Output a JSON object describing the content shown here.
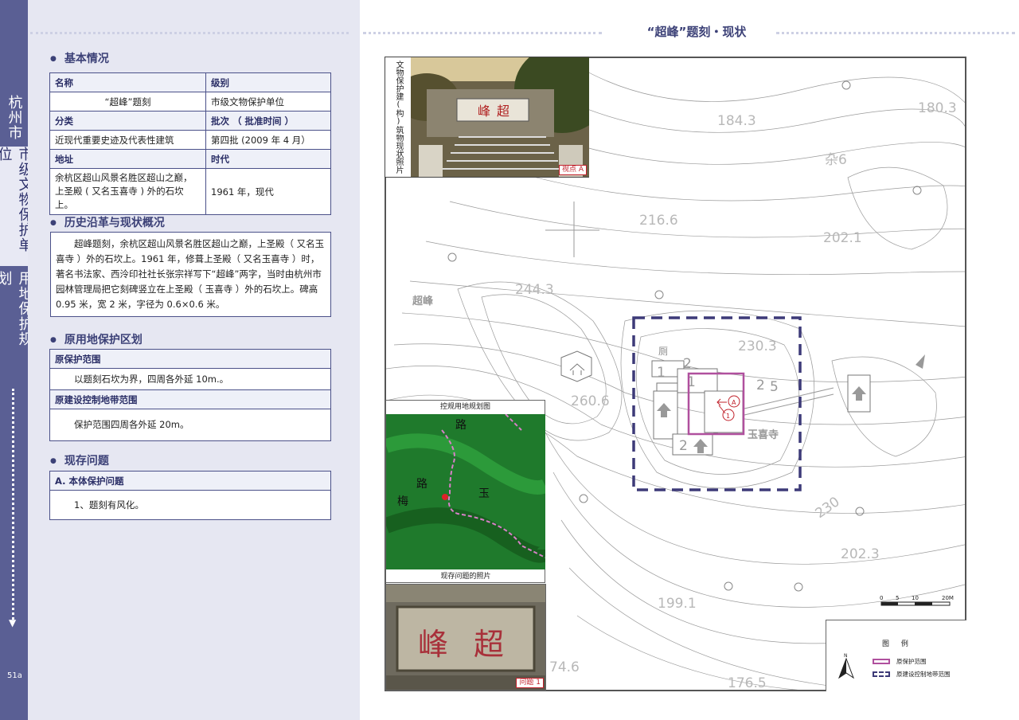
{
  "sidebar": {
    "city": "杭州市",
    "category": "市级文物保护单位",
    "section": "用地保护规划",
    "page_number": "51a"
  },
  "basic_info": {
    "title": "基本情况",
    "rows": [
      {
        "label_left": "名称",
        "label_right": "级别"
      },
      {
        "value_left": "“超峰”题刻",
        "value_right": "市级文物保护单位"
      },
      {
        "label_left": "分类",
        "label_right": "批次 （ 批准时间 ）"
      },
      {
        "value_left": "近现代重要史迹及代表性建筑",
        "value_right": "第四批 (2009 年 4 月）"
      },
      {
        "label_left": "地址",
        "label_right": "时代"
      },
      {
        "value_left_1": "余杭区超山风景名胜区超山之巅，",
        "value_left_2": "上圣殿 ( 又名玉喜寺 ) 外的石坎上。",
        "value_right": "1961 年，现代"
      }
    ]
  },
  "history": {
    "title": "历史沿革与现状概况",
    "text": "超峰题刻，余杭区超山风景名胜区超山之巅，上圣殿（ 又名玉喜寺 ）外的石坎上。1961 年，修葺上圣殿（ 又名玉喜寺 ）时，著名书法家、西泠印社社长张宗祥写下“超峰”两字，当时由杭州市园林管理局把它刻碑竖立在上圣殿（ 玉喜寺 ）外的石坎上。碑高 0.95 米，宽 2 米，字径为 0.6×0.6 米。"
  },
  "protection": {
    "title": "原用地保护区划",
    "scope_label": "原保护范围",
    "scope_text": "以题刻石坎为界，四周各外延 10m.。",
    "buffer_label": "原建设控制地带范围",
    "buffer_text": "保护范围四周各外延 20m。"
  },
  "issues": {
    "title": "现存问题",
    "sub_label": "A. 本体保护问题",
    "item": "1、题刻有风化。"
  },
  "map": {
    "page_title": "“超峰”题刻・现状",
    "photo_caption_vertical": "文物保护建(构)筑物现状照片",
    "viewpoint_tag": "视点 A",
    "plan_caption": "控规用地规划图",
    "problem_caption": "现存问题的照片",
    "problem_tag": "问题 1",
    "peak_label": "超峰",
    "temple_label": "玉喜寺",
    "toilet_label": "厕",
    "elevations": [
      "184.3",
      "180.3",
      "216.6",
      "202.1",
      "244.3",
      "230.3",
      "260.6",
      "230",
      "202.3",
      "199.1",
      "176.5",
      "74.6"
    ],
    "building_numbers": [
      "1",
      "2",
      "2",
      "1",
      "2",
      "5"
    ],
    "marker_a": "A",
    "marker_1": "1",
    "plan_roads": [
      "路",
      "路",
      "梅",
      "玉"
    ],
    "photo_characters": [
      "峰",
      "超"
    ],
    "scale_labels": [
      "0",
      "5",
      "10",
      "20M"
    ],
    "north_label": "N",
    "legend_title": "图 例",
    "legend_items": [
      "原保护范围",
      "原建设控制地带范围"
    ],
    "colors": {
      "protection": "#b0509e",
      "buffer": "#3d3a78",
      "marker": "#c0202a"
    }
  }
}
